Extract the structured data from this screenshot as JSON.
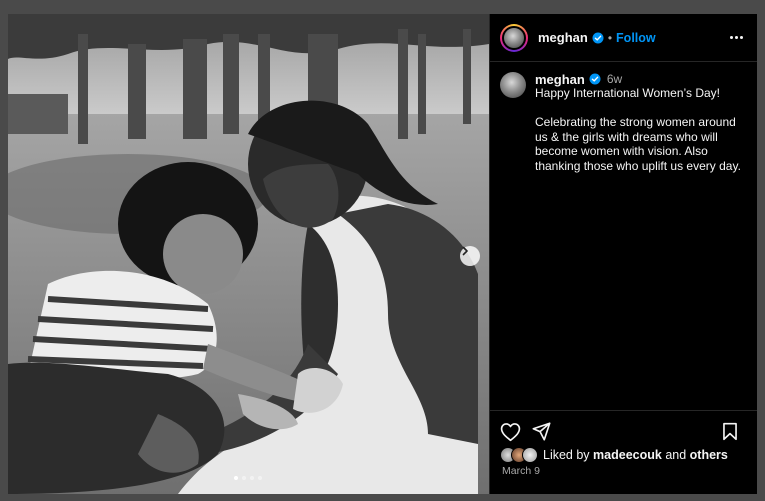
{
  "post": {
    "username": "meghan",
    "follow_label": "Follow",
    "separator": "•",
    "caption_username": "meghan",
    "time_ago": "6w",
    "caption": "Happy International Women’s Day!\n\nCelebrating the strong women around us & the girls with dreams who will become women with vision. Also thanking those who uplift us every day.",
    "liked_prefix": "Liked by",
    "liked_user": "madeecouk",
    "liked_and": "and",
    "liked_others": "others",
    "date": "March 9",
    "carousel": {
      "count": 4,
      "active_index": 0
    }
  },
  "icons": {
    "verified": "verified-badge-icon",
    "more": "more-options-icon",
    "next": "chevron-right-icon",
    "like": "heart-icon",
    "share": "paper-plane-icon",
    "save": "bookmark-icon"
  },
  "colors": {
    "accent": "#0095f6",
    "background": "#000000",
    "verified": "#0095f6",
    "muted": "#a8a8a8"
  }
}
